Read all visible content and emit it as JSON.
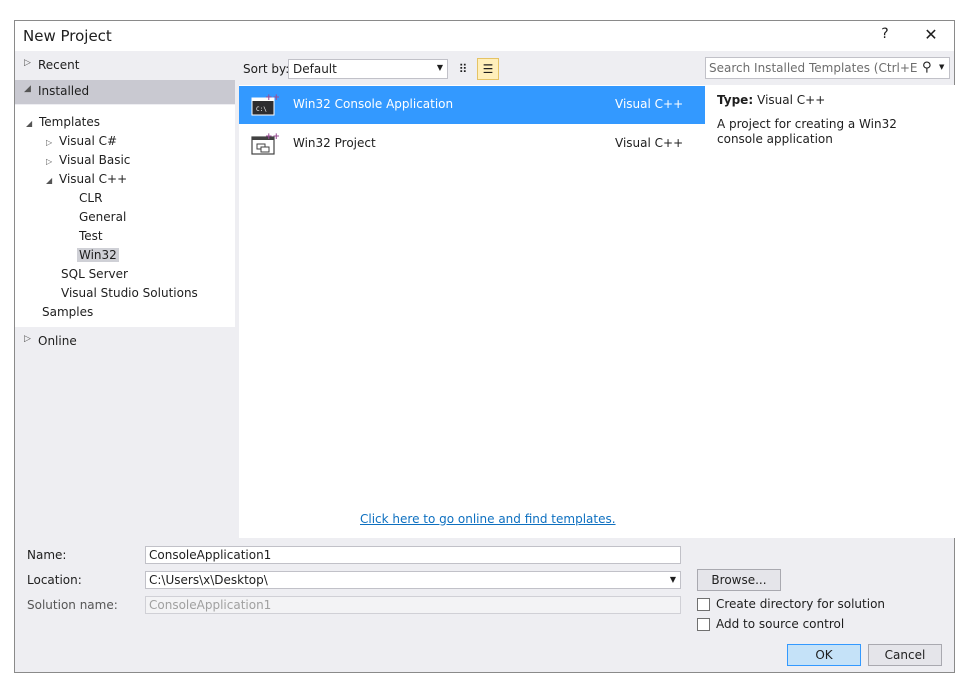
{
  "window": {
    "title": "New Project",
    "help_label": "?",
    "close_label": "✕"
  },
  "nav": {
    "recent": "Recent",
    "installed": "Installed",
    "online": "Online",
    "tree": [
      {
        "label": "Templates",
        "arrow": "◢"
      },
      {
        "label": "Visual C#",
        "arrow": "▷"
      },
      {
        "label": "Visual Basic",
        "arrow": "▷"
      },
      {
        "label": "Visual C++",
        "arrow": "◢"
      },
      {
        "label": "CLR",
        "arrow": ""
      },
      {
        "label": "General",
        "arrow": ""
      },
      {
        "label": "Test",
        "arrow": ""
      },
      {
        "label": "Win32",
        "arrow": ""
      },
      {
        "label": "SQL Server",
        "arrow": ""
      },
      {
        "label": "Visual Studio Solutions",
        "arrow": ""
      },
      {
        "label": "Samples",
        "arrow": ""
      }
    ],
    "arrow_collapsed": "▷",
    "arrow_expanded": "◢"
  },
  "sortbar": {
    "label": "Sort by:",
    "value": "Default",
    "caret": "▼",
    "grid_icon": "⠿",
    "list_icon": "☰"
  },
  "templates": [
    {
      "name": "Win32 Console Application",
      "lang": "Visual C++",
      "icon": "console-app-icon"
    },
    {
      "name": "Win32 Project",
      "lang": "Visual C++",
      "icon": "win32-project-icon"
    }
  ],
  "online_link": "Click here to go online and find templates.",
  "search": {
    "placeholder": "Search Installed Templates (Ctrl+E)",
    "icon": "⚲",
    "caret": "▼"
  },
  "details": {
    "type_key": "Type:",
    "type_value": "Visual C++",
    "description": "A project for creating a Win32 console application"
  },
  "form": {
    "name_label": "Name:",
    "name_value": "ConsoleApplication1",
    "location_label": "Location:",
    "location_value": "C:\\Users\\x\\Desktop\\",
    "location_caret": "▼",
    "solution_label": "Solution name:",
    "solution_value": "ConsoleApplication1",
    "browse_label": "Browse...",
    "create_dir_label": "Create directory for solution",
    "source_control_label": "Add to source control",
    "ok_label": "OK",
    "cancel_label": "Cancel"
  },
  "colors": {
    "selection": "#3399ff",
    "link": "#0e70c0",
    "chrome": "#eeeef2"
  }
}
